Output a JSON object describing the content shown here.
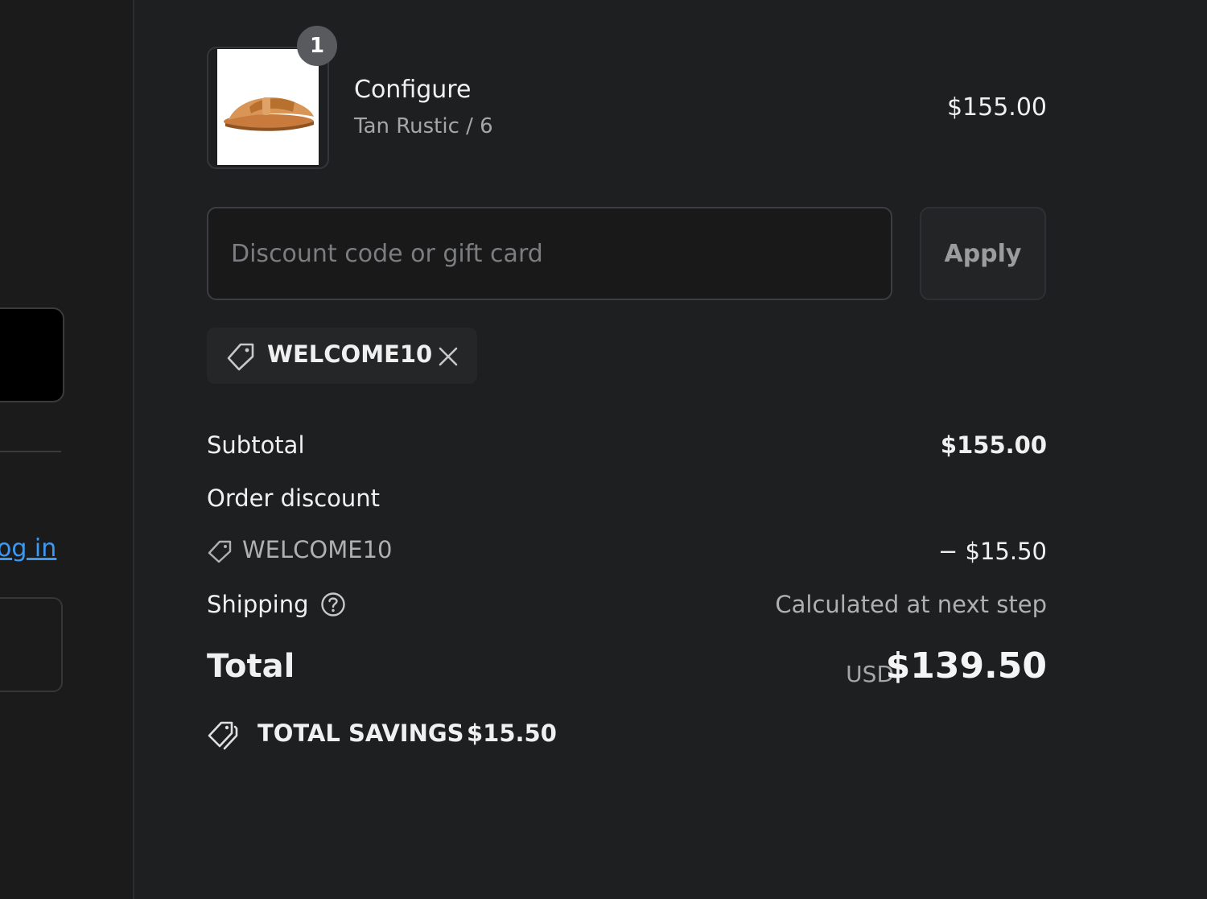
{
  "left": {
    "login_link": "og in"
  },
  "cart": {
    "item": {
      "quantity": "1",
      "name": "Configure",
      "variant": "Tan Rustic / 6",
      "price": "$155.00"
    }
  },
  "discount": {
    "placeholder": "Discount code or gift card",
    "value": "",
    "apply_label": "Apply",
    "applied_code": "WELCOME10"
  },
  "summary": {
    "subtotal_label": "Subtotal",
    "subtotal_value": "$155.00",
    "order_discount_label": "Order discount",
    "discount_code": "WELCOME10",
    "discount_amount": "− $15.50",
    "shipping_label": "Shipping",
    "shipping_value": "Calculated at next step",
    "total_label": "Total",
    "currency": "USD",
    "total_value": "$139.50",
    "savings_label": "TOTAL SAVINGS",
    "savings_value": "$15.50"
  },
  "colors": {
    "background": "#1e1f21",
    "link": "#3d9af0",
    "text": "#f0f0f0",
    "muted": "#a6a6a6"
  },
  "icons": [
    "tag-icon",
    "close-icon",
    "help-icon",
    "savings-tags-icon",
    "product-image"
  ]
}
